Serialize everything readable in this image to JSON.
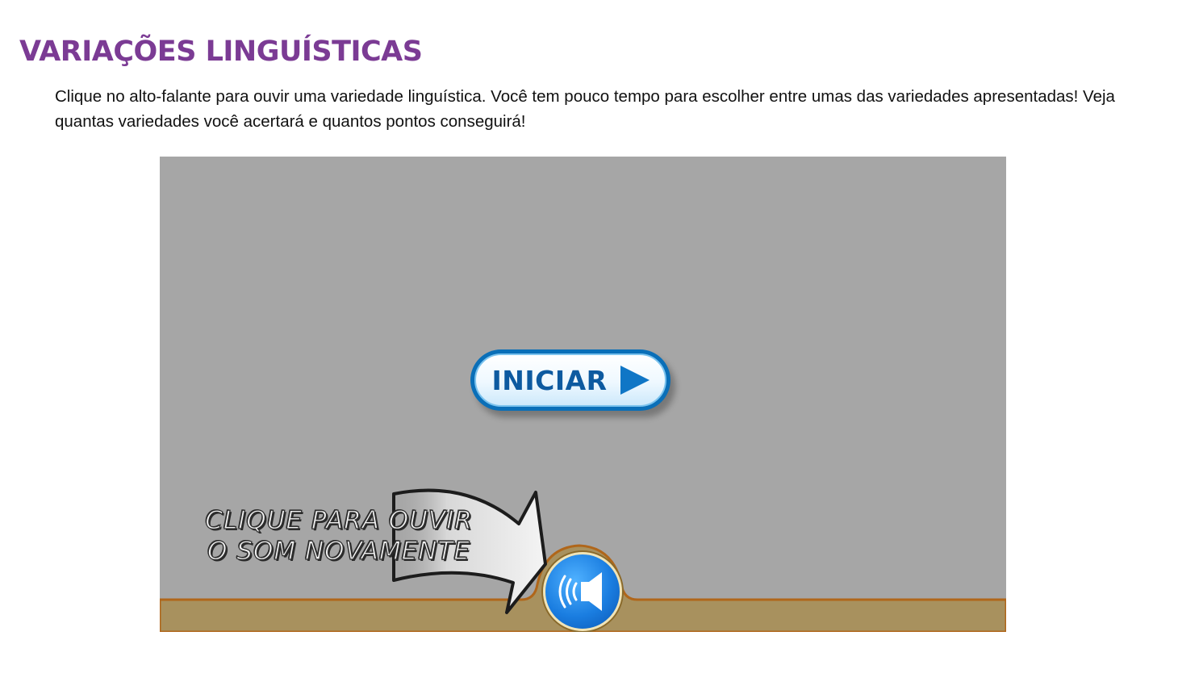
{
  "title": "VARIAÇÕES LINGUÍSTICAS",
  "instructions": "Clique no alto-falante para ouvir uma variedade linguística. Você tem pouco tempo para escolher entre umas das variedades apresentadas! Veja quantas variedades você acertará e quantos pontos conseguirá!",
  "game": {
    "start_label": "INICIAR",
    "start_icon": "play-icon",
    "hint_line1": "CLIQUE PARA OUVIR",
    "hint_line2": "O SOM NOVAMENTE",
    "sound_icon": "speaker-icon",
    "arrow_icon": "arrow-icon",
    "colors": {
      "title": "#7b3b94",
      "stage_bg": "#a6a6a6",
      "floor": "#a8915e",
      "floor_edge": "#b0661a",
      "button_blue": "#0a6fb8"
    }
  }
}
